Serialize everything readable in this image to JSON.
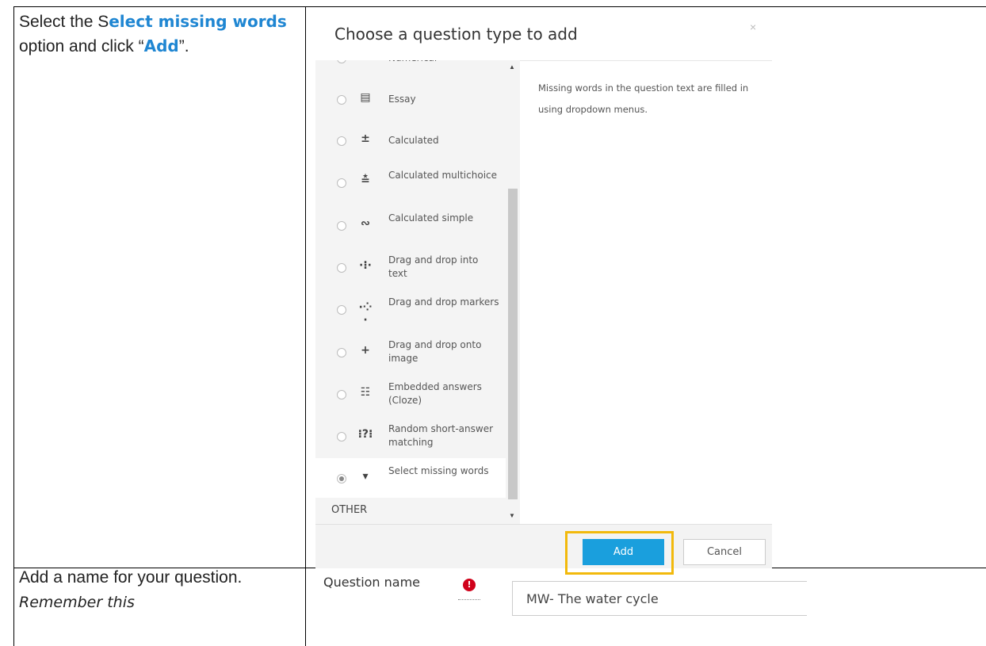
{
  "instructions": {
    "step1": {
      "prefix": "Select the S",
      "highlight": "elect missing words",
      "middle": " option and click “",
      "add_word": "Add",
      "suffix": "”."
    },
    "step2": {
      "text": "Add a name for your question. ",
      "italic": "Remember this"
    }
  },
  "dialog": {
    "title": "Choose a question type to add",
    "close_icon": "×",
    "question_types": [
      {
        "icon": "numerical-icon",
        "glyph": "≐",
        "label": "Numerical"
      },
      {
        "icon": "essay-icon",
        "glyph": "▤",
        "label": "Essay"
      },
      {
        "icon": "calculated-icon",
        "glyph": "±",
        "label": "Calculated"
      },
      {
        "icon": "calculated-multichoice-icon",
        "glyph": "≛",
        "label": "Calculated multichoice"
      },
      {
        "icon": "calculated-simple-icon",
        "glyph": "∾",
        "label": "Calculated simple"
      },
      {
        "icon": "drag-drop-text-icon",
        "glyph": "·⁝·",
        "label": "Drag and drop into text"
      },
      {
        "icon": "drag-drop-markers-icon",
        "glyph": "·⁘·",
        "label": "Drag and drop markers"
      },
      {
        "icon": "drag-drop-image-icon",
        "glyph": "+",
        "label": "Drag and drop onto image"
      },
      {
        "icon": "cloze-icon",
        "glyph": "☷",
        "label": "Embedded answers (Cloze)"
      },
      {
        "icon": "random-shortanswer-icon",
        "glyph": "⁝?⁝",
        "label": "Random short-answer matching"
      },
      {
        "icon": "dropdown-icon",
        "glyph": "▾",
        "label": "Select missing words",
        "selected": true
      }
    ],
    "category_other": "OTHER",
    "description": "Missing words in the question text are filled in using dropdown menus.",
    "add_label": "Add",
    "cancel_label": "Cancel",
    "accent_color": "#1a9fdd",
    "highlight_color": "#f2b90c"
  },
  "question_name": {
    "label": "Question name",
    "required_icon": "!",
    "value": "MW- The water cycle"
  }
}
